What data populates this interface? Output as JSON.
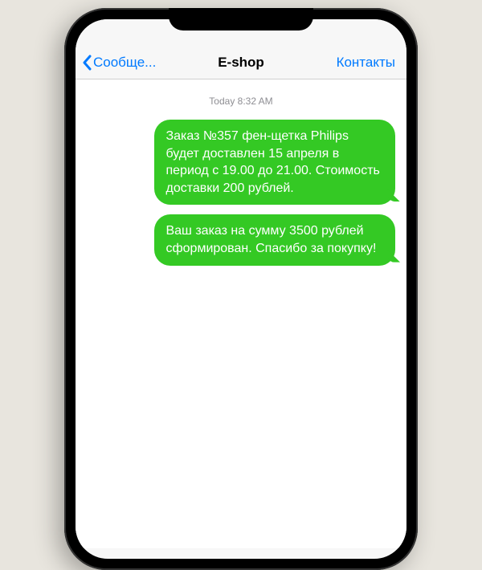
{
  "header": {
    "back_label": "Сообще...",
    "title": "E-shop",
    "contacts_label": "Контакты"
  },
  "thread": {
    "timestamp": "Today 8:32 AM",
    "messages": [
      "Заказ №357 фен-щетка Philips будет доставлен 15 апреля в период с 19.00 до 21.00. Стоимость доставки 200 рублей.",
      "Ваш заказ на сумму 3500 рублей сформирован. Спасибо за покупку!"
    ]
  }
}
